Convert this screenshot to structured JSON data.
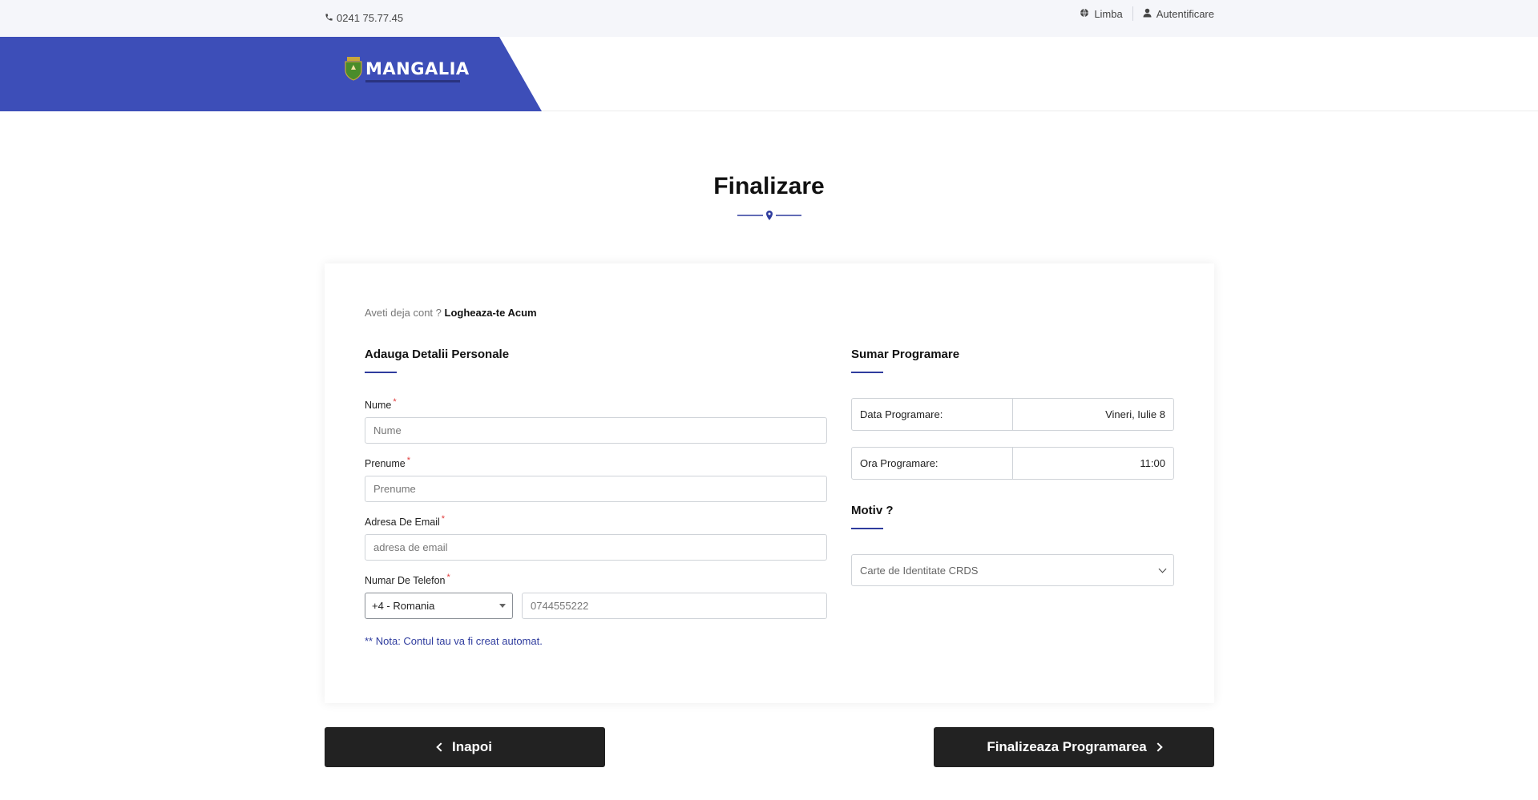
{
  "topbar": {
    "phone": "0241 75.77.45",
    "language_label": "Limba",
    "login_label": "Autentificare"
  },
  "header": {
    "logo_text": "MANGALIA"
  },
  "page": {
    "title": "Finalizare"
  },
  "account": {
    "prompt": "Aveti deja cont ?",
    "login_link": "Logheaza-te Acum"
  },
  "personal": {
    "section_title": "Adauga Detalii Personale",
    "nume_label": "Nume",
    "nume_placeholder": "Nume",
    "prenume_label": "Prenume",
    "prenume_placeholder": "Prenume",
    "email_label": "Adresa De Email",
    "email_placeholder": "adresa de email",
    "telefon_label": "Numar De Telefon",
    "country_selected": "+4 - Romania",
    "telefon_placeholder": "0744555222",
    "required_mark": "*",
    "note": "** Nota: Contul tau va fi creat automat."
  },
  "summary": {
    "section_title": "Sumar Programare",
    "date_label": "Data Programare:",
    "date_value": "Vineri, Iulie 8",
    "time_label": "Ora Programare:",
    "time_value": "11:00",
    "motiv_title": "Motiv ?",
    "motiv_selected": "Carte de Identitate CRDS"
  },
  "actions": {
    "back_label": "Inapoi",
    "finish_label": "Finalizeaza Programarea"
  },
  "colors": {
    "brand_blue": "#3d4eb8",
    "accent_blue": "#2f3c9e",
    "button_dark": "#222222",
    "required_red": "#e03a3a"
  }
}
